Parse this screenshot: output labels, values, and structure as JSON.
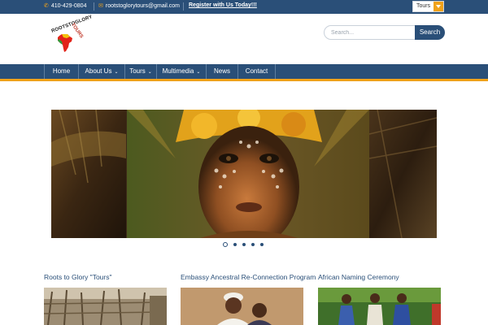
{
  "topbar": {
    "phone": "410-429-0804",
    "email": "rootstoglorytours@gmail.com",
    "register": "Register with Us Today!!!",
    "select_value": "Tours",
    "icons": {
      "phone": "phone-icon",
      "email": "envelope-icon"
    }
  },
  "logo": {
    "text_top": "ROOTSTOGLORY",
    "text_side": "TOURS"
  },
  "search": {
    "placeholder": "Search...",
    "button": "Search"
  },
  "nav": {
    "items": [
      {
        "label": "Home",
        "dropdown": false
      },
      {
        "label": "About Us",
        "dropdown": true
      },
      {
        "label": "Tours",
        "dropdown": true
      },
      {
        "label": "Multimedia",
        "dropdown": true
      },
      {
        "label": "News",
        "dropdown": false
      },
      {
        "label": "Contact",
        "dropdown": false
      }
    ]
  },
  "slider": {
    "dot_count": 5,
    "active_dot": 0
  },
  "sections": [
    {
      "title": "Roots to Glory \"Tours\""
    },
    {
      "title": "Embassy Ancestral Re-Connection Program"
    },
    {
      "title": "African Naming Ceremony"
    }
  ],
  "colors": {
    "brand_blue": "#2a4f78",
    "accent_orange": "#f0a21a"
  }
}
